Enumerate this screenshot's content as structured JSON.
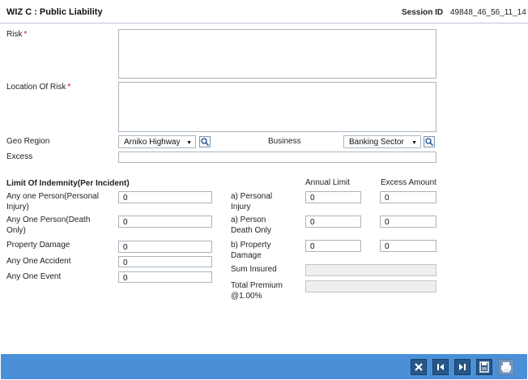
{
  "header": {
    "title": "WIZ C : Public Liability",
    "session_label": "Session ID",
    "session_id": "49848_46_56_11_14"
  },
  "form": {
    "risk_label": "Risk",
    "location_label": "Location Of Risk",
    "required_mark": "*",
    "geo_region_label": "Geo Region",
    "geo_region_value": "Arniko Highway",
    "business_label": "Business",
    "business_value": "Banking Sector",
    "excess_label": "Excess"
  },
  "indemnity": {
    "section_title": "Limit Of Indemnity(Per Incident)",
    "rows": [
      {
        "label": "Any one Person(Personal Injury)",
        "value": "0"
      },
      {
        "label": "Any One Person(Death Only)",
        "value": "0"
      },
      {
        "label": "Property Damage",
        "value": "0"
      },
      {
        "label": "Any One Accident",
        "value": "0"
      },
      {
        "label": "Any One Event",
        "value": "0"
      }
    ]
  },
  "limits": {
    "annual_limit_header": "Annual Limit",
    "excess_amount_header": "Excess Amount",
    "rows": [
      {
        "label": "a) Personal Injury",
        "annual": "0",
        "excess": "0"
      },
      {
        "label": "a) Person Death Only",
        "annual": "0",
        "excess": "0"
      },
      {
        "label": "b) Property Damage",
        "annual": "0",
        "excess": "0"
      }
    ],
    "sum_insured_label": "Sum Insured",
    "total_premium_label": "Total Premium @1.00%"
  },
  "footer": {
    "icons": [
      "close-icon",
      "first-icon",
      "last-icon",
      "save-icon",
      "print-icon"
    ]
  }
}
